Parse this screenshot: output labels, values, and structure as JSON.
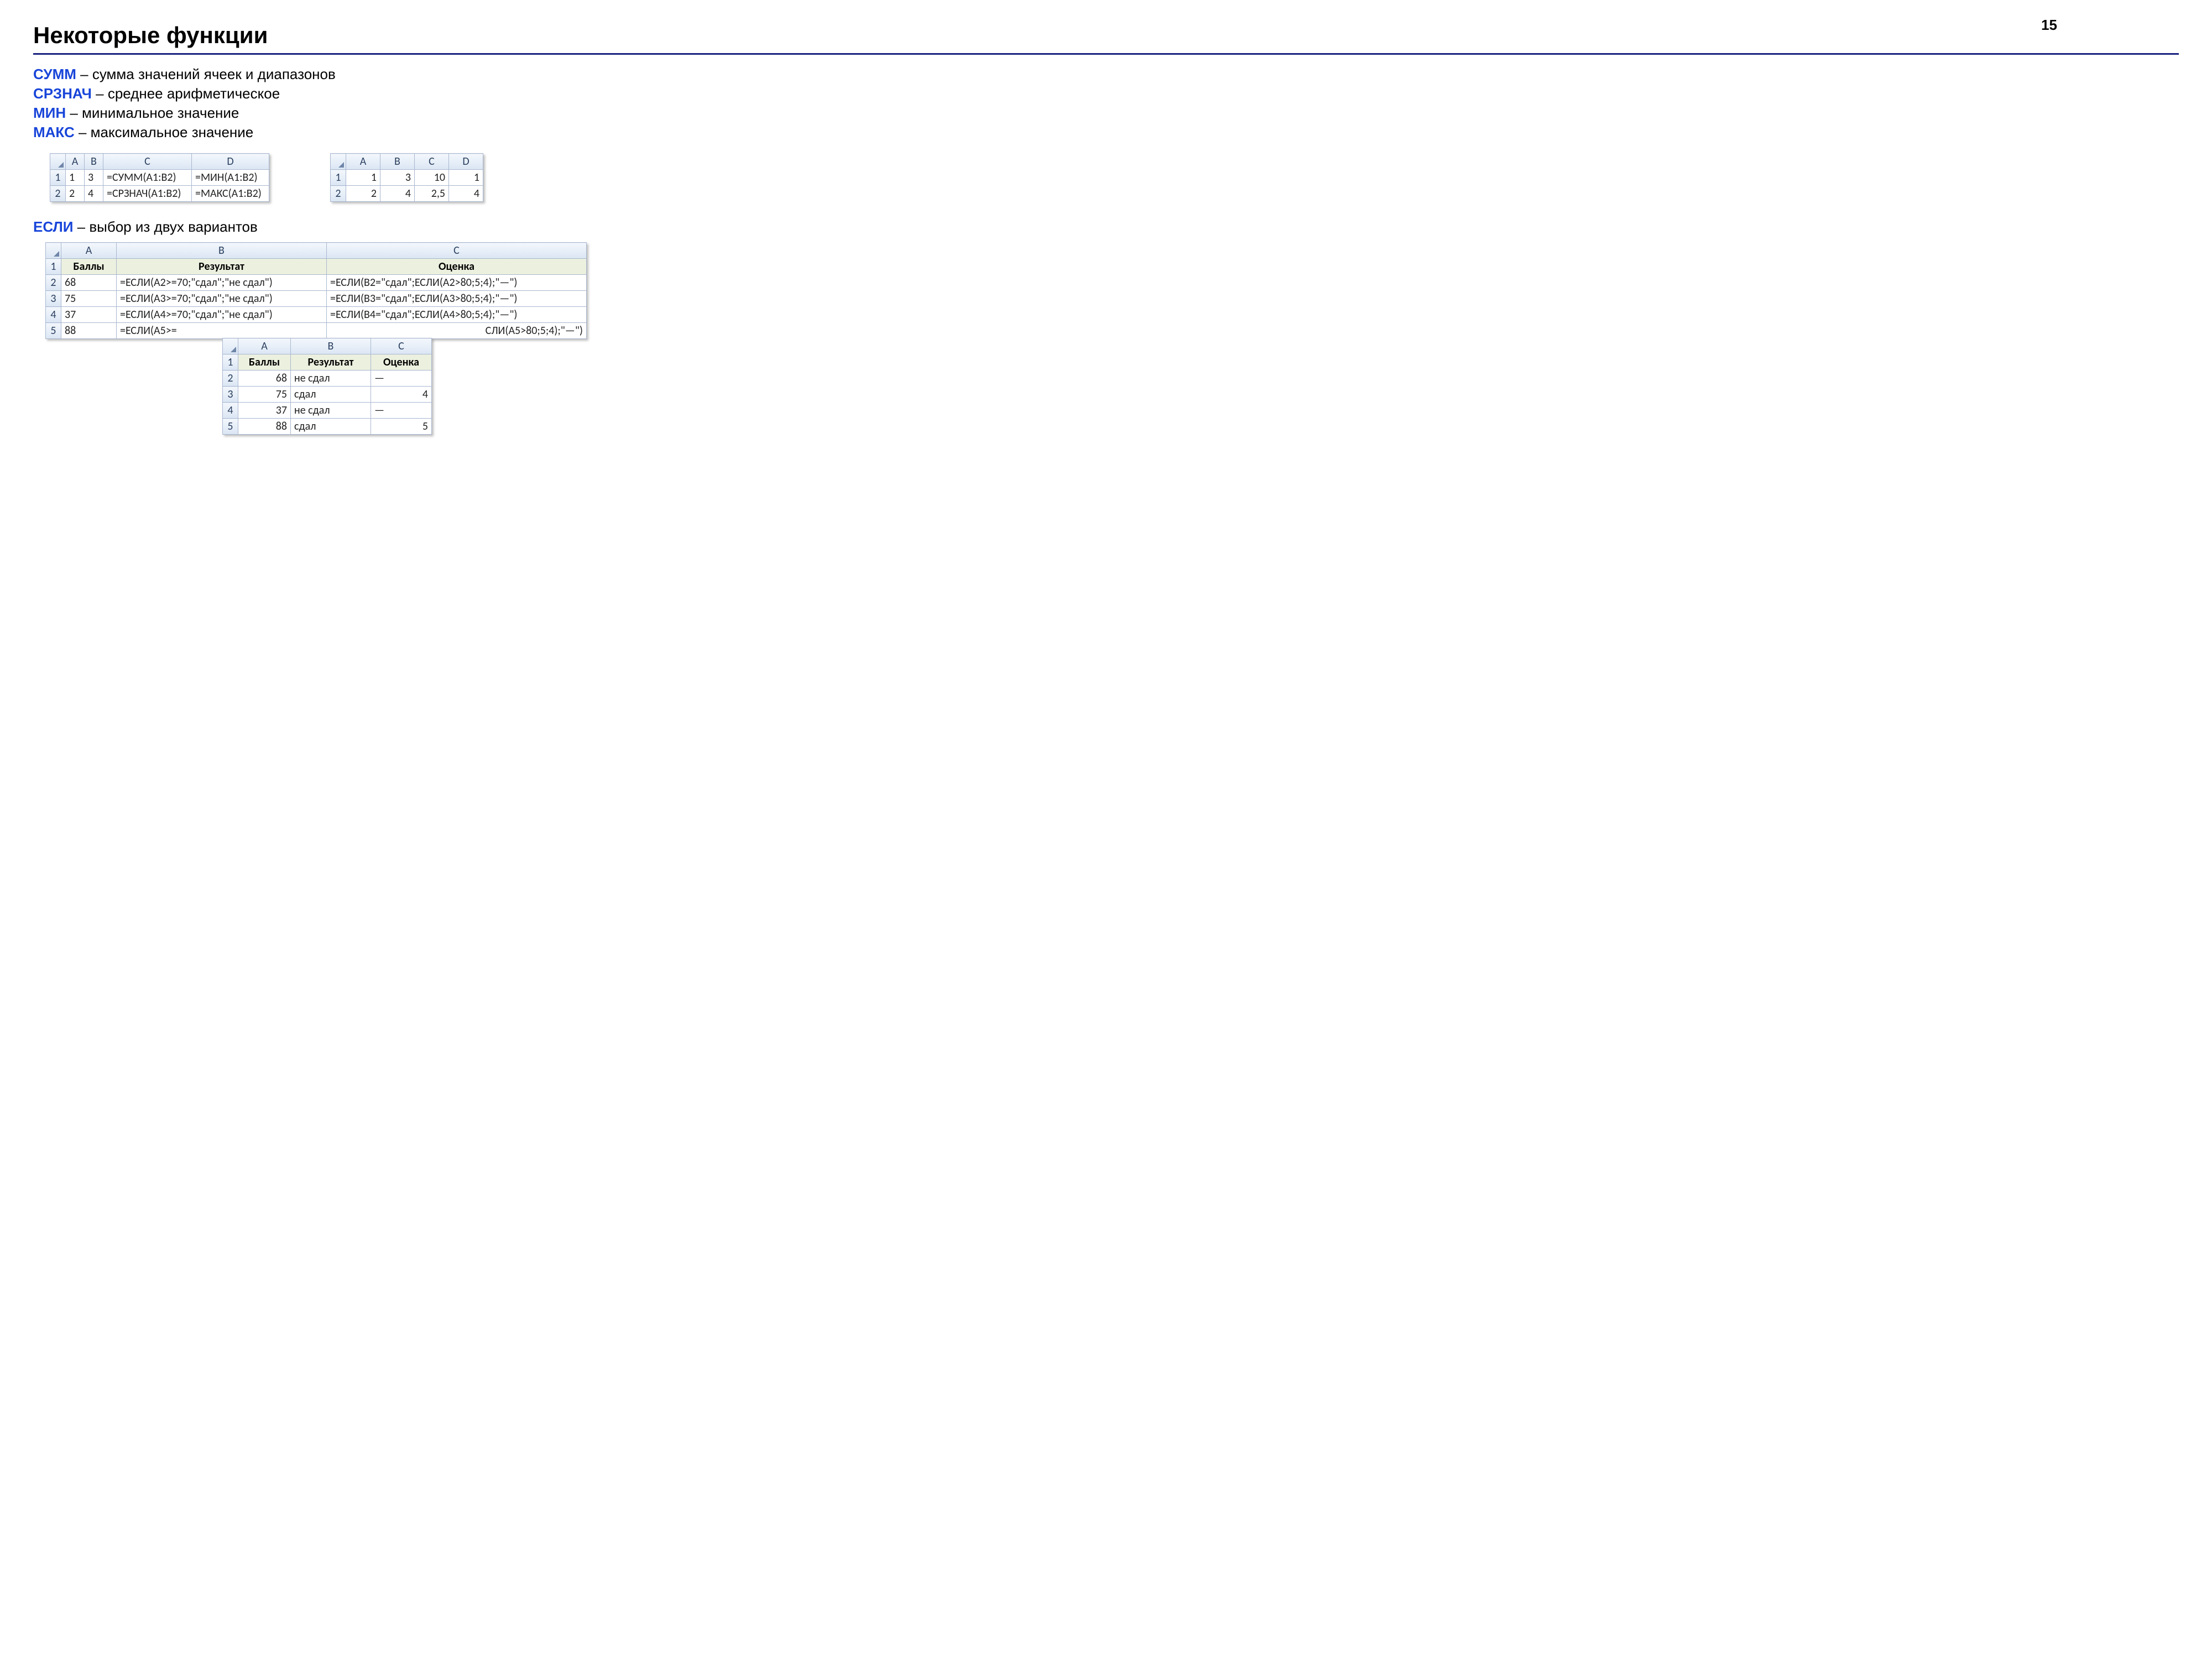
{
  "page_number": "15",
  "title": "Некоторые функции",
  "defs": [
    {
      "kw": "СУММ",
      "text": " – сумма значений ячеек и диапазонов"
    },
    {
      "kw": "СРЗНАЧ",
      "text": " – среднее арифметическое"
    },
    {
      "kw": "МИН",
      "text": " – минимальное значение"
    },
    {
      "kw": "МАКС",
      "text": " – максимальное значение"
    }
  ],
  "table1": {
    "cols": [
      "A",
      "B",
      "C",
      "D"
    ],
    "rows": [
      {
        "n": "1",
        "a": "1",
        "b": "3",
        "c": "=СУММ(A1:B2)",
        "d": "=МИН(A1:B2)"
      },
      {
        "n": "2",
        "a": "2",
        "b": "4",
        "c": "=СРЗНАЧ(A1:B2)",
        "d": "=МАКС(A1:B2)"
      }
    ]
  },
  "table2": {
    "cols": [
      "A",
      "B",
      "C",
      "D"
    ],
    "rows": [
      {
        "n": "1",
        "a": "1",
        "b": "3",
        "c": "10",
        "d": "1"
      },
      {
        "n": "2",
        "a": "2",
        "b": "4",
        "c": "2,5",
        "d": "4"
      }
    ]
  },
  "if_section": {
    "kw": "ЕСЛИ",
    "text": " – выбор из двух вариантов"
  },
  "table3": {
    "cols": [
      "A",
      "B",
      "C"
    ],
    "header_row": {
      "n": "1",
      "a": "Баллы",
      "b": "Результат",
      "c": "Оценка"
    },
    "rows": [
      {
        "n": "2",
        "a": "68",
        "b": "=ЕСЛИ(A2>=70;\"сдал\";\"не сдал\")",
        "c": "=ЕСЛИ(B2=\"сдал\";ЕСЛИ(A2>80;5;4);\"—\")"
      },
      {
        "n": "3",
        "a": "75",
        "b": "=ЕСЛИ(A3>=70;\"сдал\";\"не сдал\")",
        "c": "=ЕСЛИ(B3=\"сдал\";ЕСЛИ(A3>80;5;4);\"—\")"
      },
      {
        "n": "4",
        "a": "37",
        "b": "=ЕСЛИ(A4>=70;\"сдал\";\"не сдал\")",
        "c": "=ЕСЛИ(B4=\"сдал\";ЕСЛИ(A4>80;5;4);\"—\")"
      },
      {
        "n": "5",
        "a": "88",
        "b": "=ЕСЛИ(A5>=",
        "c": "СЛИ(A5>80;5;4);\"—\")"
      }
    ]
  },
  "table4": {
    "cols": [
      "A",
      "B",
      "C"
    ],
    "header_row": {
      "n": "1",
      "a": "Баллы",
      "b": "Результат",
      "c": "Оценка"
    },
    "rows": [
      {
        "n": "2",
        "a": "68",
        "b": "не сдал",
        "c": "—"
      },
      {
        "n": "3",
        "a": "75",
        "b": "сдал",
        "c": "4"
      },
      {
        "n": "4",
        "a": "37",
        "b": "не сдал",
        "c": "—"
      },
      {
        "n": "5",
        "a": "88",
        "b": "сдал",
        "c": "5"
      }
    ]
  }
}
